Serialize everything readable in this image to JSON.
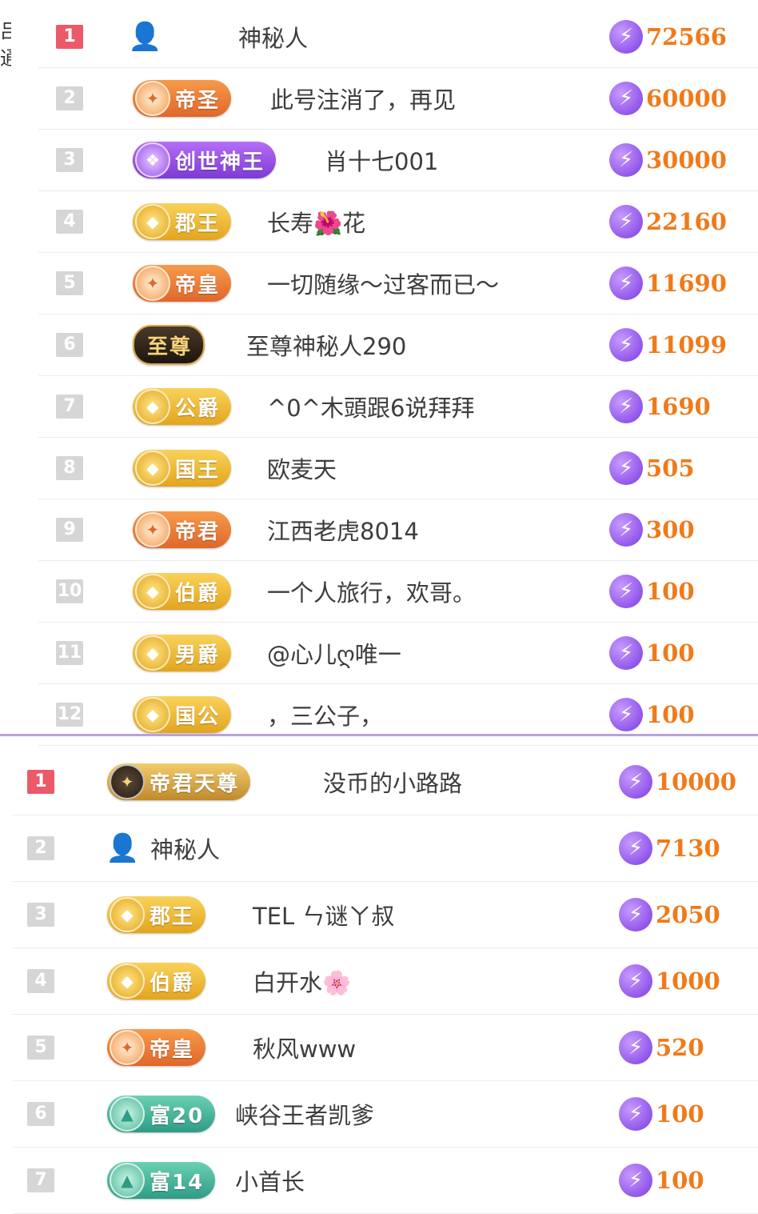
{
  "edge_text": "吕 通",
  "icons": {
    "bolt": "⚡",
    "spy": "👤",
    "flower": "🌺"
  },
  "colors": {
    "rank_first": "#ec5a6a",
    "rank_default": "#d6d6d6",
    "score": "#f07a1a",
    "divider": "#b9a2da"
  },
  "top_list": [
    {
      "rank": "1",
      "badge": "",
      "name": "神秘人",
      "score": "72566",
      "spy": true
    },
    {
      "rank": "2",
      "badge": "帝圣",
      "emblem": "✦",
      "style": "orange",
      "name": "此号注消了，再见",
      "score": "60000"
    },
    {
      "rank": "3",
      "badge": "创世神王",
      "emblem": "❖",
      "style": "purple",
      "name": "肖十七001",
      "score": "30000"
    },
    {
      "rank": "4",
      "badge": "郡王",
      "emblem": "◆",
      "style": "gold",
      "name": "长寿🌺花",
      "score": "22160"
    },
    {
      "rank": "5",
      "badge": "帝皇",
      "emblem": "✦",
      "style": "orange",
      "name": "一切随缘～过客而已～",
      "score": "11690"
    },
    {
      "rank": "6",
      "badge": "至尊",
      "emblem": "",
      "style": "dark",
      "name": "至尊神秘人290",
      "score": "11099"
    },
    {
      "rank": "7",
      "badge": "公爵",
      "emblem": "◆",
      "style": "gold",
      "name": "^0^木頭跟6说拜拜",
      "score": "1690"
    },
    {
      "rank": "8",
      "badge": "国王",
      "emblem": "◆",
      "style": "gold",
      "name": "欧麦天",
      "score": "505"
    },
    {
      "rank": "9",
      "badge": "帝君",
      "emblem": "✦",
      "style": "orange",
      "name": "江西老虎8014",
      "score": "300"
    },
    {
      "rank": "10",
      "badge": "伯爵",
      "emblem": "◆",
      "style": "gold",
      "name": "一个人旅行，欢哥。",
      "score": "100"
    },
    {
      "rank": "11",
      "badge": "男爵",
      "emblem": "◆",
      "style": "gold",
      "name": "@心儿ღ唯一",
      "score": "100"
    },
    {
      "rank": "12",
      "badge": "国公",
      "emblem": "◆",
      "style": "gold",
      "name": "，三公子，",
      "score": "100"
    }
  ],
  "bottom_list": [
    {
      "rank": "1",
      "badge": "帝君天尊",
      "emblem": "✦",
      "style": "darkgold",
      "name": "没币的小路路",
      "score": "10000"
    },
    {
      "rank": "2",
      "badge": "",
      "name": "神秘人",
      "score": "7130",
      "spy": true
    },
    {
      "rank": "3",
      "badge": "郡王",
      "emblem": "◆",
      "style": "gold",
      "name": "TEL ㄣ谜ㄚ叔",
      "score": "2050"
    },
    {
      "rank": "4",
      "badge": "伯爵",
      "emblem": "◆",
      "style": "gold",
      "name": "白开水🌸",
      "score": "1000"
    },
    {
      "rank": "5",
      "badge": "帝皇",
      "emblem": "✦",
      "style": "orange",
      "name": "秋风www",
      "score": "520"
    },
    {
      "rank": "6",
      "badge": "富20",
      "emblem": "▲",
      "style": "teal",
      "name": "峡谷王者凯爹",
      "score": "100"
    },
    {
      "rank": "7",
      "badge": "富14",
      "emblem": "▲",
      "style": "teal",
      "name": "小首长",
      "score": "100"
    }
  ]
}
